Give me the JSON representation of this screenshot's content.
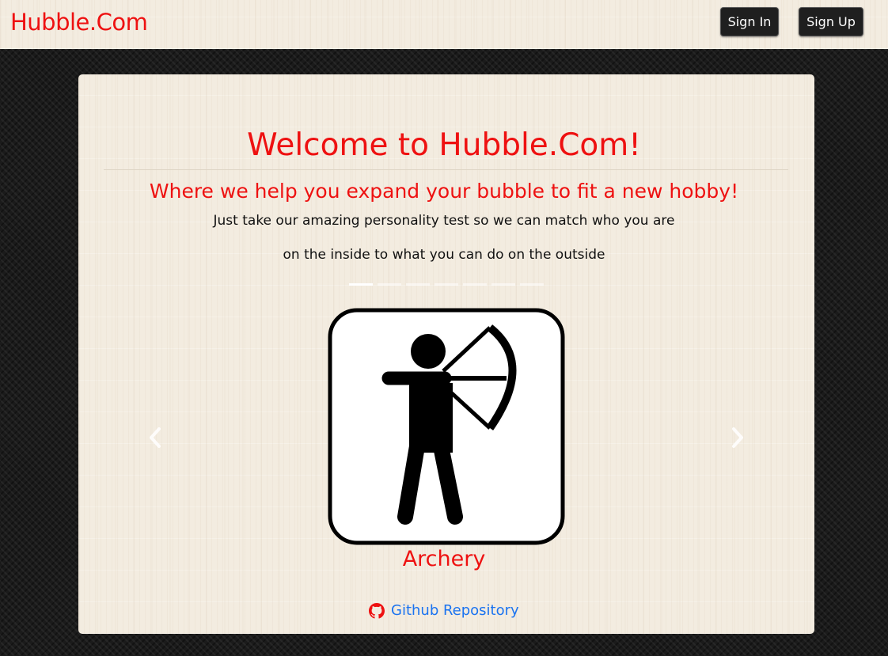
{
  "navbar": {
    "brand": "Hubble.Com",
    "sign_in_label": "Sign In",
    "sign_up_label": "Sign Up"
  },
  "hero": {
    "title": "Welcome to Hubble.Com!",
    "subtitle": "Where we help you expand your bubble to fit a new hobby!",
    "lead_line_1": "Just take our amazing personality test so we can match who you are",
    "lead_line_2": "on the inside to what you can do on the outside"
  },
  "carousel": {
    "slide_count": 7,
    "active_index": 0,
    "current_caption": "Archery",
    "current_icon": "archery-icon",
    "prev_icon": "chevron-left-icon",
    "next_icon": "chevron-right-icon"
  },
  "footer_link": {
    "label": "Github Repository",
    "icon": "github-icon"
  },
  "colors": {
    "accent_red": "#ee1111",
    "link_blue": "#1a73f0",
    "button_dark": "#1f1f1f"
  }
}
